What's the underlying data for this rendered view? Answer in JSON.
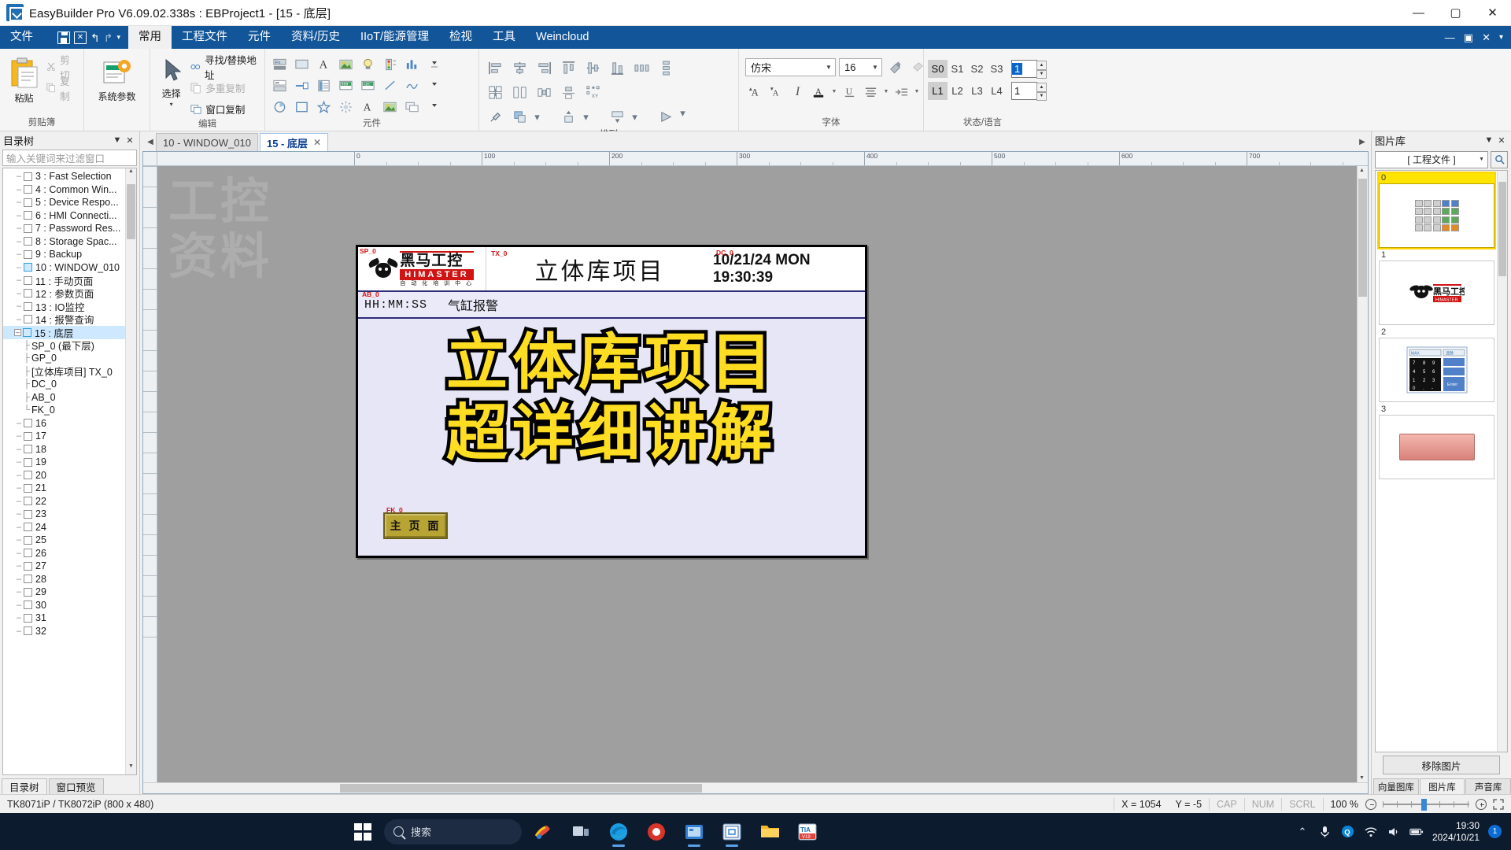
{
  "titlebar": {
    "title": "EasyBuilder Pro V6.09.02.338s : EBProject1 - [15 - 底层]",
    "minimize": "—",
    "maximize": "▢",
    "close": "✕",
    "app_icon": "easybuilder-logo-icon"
  },
  "menubar": {
    "items": [
      {
        "label": "文件",
        "active": false
      },
      {
        "label": "常用",
        "active": true
      },
      {
        "label": "工程文件",
        "active": false
      },
      {
        "label": "元件",
        "active": false
      },
      {
        "label": "资料/历史",
        "active": false
      },
      {
        "label": "IIoT/能源管理",
        "active": false
      },
      {
        "label": "检视",
        "active": false
      },
      {
        "label": "工具",
        "active": false
      },
      {
        "label": "Weincloud",
        "active": false
      }
    ],
    "quick_access": [
      "save-icon",
      "export-icon",
      "undo-icon",
      "redo-icon",
      "customize-icon"
    ],
    "window_controls": [
      "—",
      "▣",
      "✕",
      "▾"
    ]
  },
  "ribbon": {
    "groups": [
      {
        "name": "剪贴簿",
        "paste_label": "粘贴",
        "cut_label": "剪切",
        "copy_label": "复制"
      },
      {
        "name": "",
        "sysparam_label": "系统参数"
      },
      {
        "name": "编辑",
        "select_label": "选择",
        "find_replace_label": "寻找/替换地址",
        "multi_copy_label": "多重复制",
        "window_copy_label": "窗口复制"
      },
      {
        "name": "元件"
      },
      {
        "name": "排列"
      },
      {
        "name": "字体",
        "font_family": "仿宋",
        "font_size": "16"
      },
      {
        "name": "状态/语言",
        "states": [
          "S0",
          "S1",
          "S2",
          "S3"
        ],
        "state_selected": "S0",
        "state_value": "1",
        "langs": [
          "L1",
          "L2",
          "L3",
          "L4"
        ],
        "lang_selected": "L1",
        "lang_value": "1"
      }
    ]
  },
  "left_panel": {
    "header": "目录树",
    "header_icons": [
      "chevron-down-icon",
      "close-icon"
    ],
    "filter_placeholder": "输入关键词来过滤窗口",
    "tree": [
      {
        "label": "3 : Fast Selection",
        "type": "window",
        "indent": 0
      },
      {
        "label": "4 : Common Win...",
        "type": "window",
        "indent": 0
      },
      {
        "label": "5 : Device Respo...",
        "type": "window",
        "indent": 0
      },
      {
        "label": "6 : HMI Connecti...",
        "type": "window",
        "indent": 0
      },
      {
        "label": "7 : Password Res...",
        "type": "window",
        "indent": 0
      },
      {
        "label": "8 : Storage Spac...",
        "type": "window",
        "indent": 0
      },
      {
        "label": "9 : Backup",
        "type": "window",
        "indent": 0
      },
      {
        "label": "10 : WINDOW_010",
        "type": "window-open",
        "indent": 0
      },
      {
        "label": "11 : 手动页面",
        "type": "window",
        "indent": 0
      },
      {
        "label": "12 : 参数页面",
        "type": "window",
        "indent": 0
      },
      {
        "label": "13 : IO监控",
        "type": "window",
        "indent": 0
      },
      {
        "label": "14 : 报警查询",
        "type": "window",
        "indent": 0
      },
      {
        "label": "15 : 底层",
        "type": "window-selected",
        "indent": 0,
        "expanded": true
      },
      {
        "label": "SP_0 (最下层)",
        "type": "child",
        "indent": 1
      },
      {
        "label": "GP_0",
        "type": "child",
        "indent": 1
      },
      {
        "label": "[立体库项目] TX_0",
        "type": "child",
        "indent": 1
      },
      {
        "label": "DC_0",
        "type": "child",
        "indent": 1
      },
      {
        "label": "AB_0",
        "type": "child",
        "indent": 1
      },
      {
        "label": "FK_0",
        "type": "child-last",
        "indent": 1
      },
      {
        "label": "16",
        "type": "window",
        "indent": 0
      },
      {
        "label": "17",
        "type": "window",
        "indent": 0
      },
      {
        "label": "18",
        "type": "window",
        "indent": 0
      },
      {
        "label": "19",
        "type": "window",
        "indent": 0
      },
      {
        "label": "20",
        "type": "window",
        "indent": 0
      },
      {
        "label": "21",
        "type": "window",
        "indent": 0
      },
      {
        "label": "22",
        "type": "window",
        "indent": 0
      },
      {
        "label": "23",
        "type": "window",
        "indent": 0
      },
      {
        "label": "24",
        "type": "window",
        "indent": 0
      },
      {
        "label": "25",
        "type": "window",
        "indent": 0
      },
      {
        "label": "26",
        "type": "window",
        "indent": 0
      },
      {
        "label": "27",
        "type": "window",
        "indent": 0
      },
      {
        "label": "28",
        "type": "window",
        "indent": 0
      },
      {
        "label": "29",
        "type": "window",
        "indent": 0
      },
      {
        "label": "30",
        "type": "window",
        "indent": 0
      },
      {
        "label": "31",
        "type": "window",
        "indent": 0
      },
      {
        "label": "32",
        "type": "window",
        "indent": 0
      }
    ],
    "tabs": [
      {
        "label": "目录树",
        "active": true
      },
      {
        "label": "窗口预览",
        "active": false
      }
    ]
  },
  "editor": {
    "tabs": [
      {
        "label": "10 - WINDOW_010",
        "active": false,
        "closable": false
      },
      {
        "label": "15 - 底层",
        "active": true,
        "closable": true,
        "close": "✕"
      }
    ],
    "ruler_ticks": [
      "0",
      "100",
      "200",
      "300",
      "400",
      "500",
      "600",
      "700"
    ],
    "watermark": "工控\n资料"
  },
  "hmi": {
    "logo": {
      "cn": "黑马工控",
      "en": "HIMASTER",
      "sub": "自 动 化 培 训 中 心",
      "tag": "SP_0"
    },
    "title": "立体库项目",
    "title_tag": "TX_0",
    "datetime": "10/21/24 MON 19:30:39",
    "datetime_tag": "DC_0",
    "alarm_time": "HH:MM:SS",
    "alarm_message": "气缸报警",
    "alarm_tag": "AB_0",
    "big_line1": "立体库项目",
    "big_line2": "超详细讲解",
    "home_button": "主 页 面",
    "home_button_tag": "FK_0"
  },
  "right_panel": {
    "header": "图片库",
    "header_icons": [
      "chevron-down-icon",
      "close-icon"
    ],
    "source_label": "[ 工程文件 ]",
    "search_icon": "search-icon",
    "items": [
      {
        "num": "0",
        "selected": true,
        "kind": "keypad"
      },
      {
        "num": "1",
        "selected": false,
        "kind": "logo"
      },
      {
        "num": "2",
        "selected": false,
        "kind": "keypad-blue"
      },
      {
        "num": "3",
        "selected": false,
        "kind": "button-red"
      }
    ],
    "remove_label": "移除图片",
    "tabs": [
      {
        "label": "向量图库",
        "active": false
      },
      {
        "label": "图片库",
        "active": true
      },
      {
        "label": "声音库",
        "active": false
      }
    ]
  },
  "statusbar": {
    "model": "TK8071iP / TK8072iP (800 x 480)",
    "coord_x": "X = 1054",
    "coord_y": "Y = -5",
    "caps": "CAP",
    "num": "NUM",
    "scrl": "SCRL",
    "zoom": "100 %"
  },
  "taskbar": {
    "start_icon": "windows-start-icon",
    "search_placeholder": "搜索",
    "search_icon": "search-icon",
    "apps": [
      {
        "name": "windows-widgets-icon"
      },
      {
        "name": "search-taskbar-icon"
      },
      {
        "name": "paint-icon"
      },
      {
        "name": "task-view-icon"
      },
      {
        "name": "edge-browser-icon"
      },
      {
        "name": "recorder-icon"
      },
      {
        "name": "app-blue-icon"
      },
      {
        "name": "easybuilder-icon"
      },
      {
        "name": "file-explorer-icon"
      },
      {
        "name": "tia-portal-icon"
      }
    ],
    "tray": [
      "chevron-up-icon",
      "microphone-icon",
      "qq-icon",
      "wifi-icon",
      "volume-icon",
      "battery-icon"
    ],
    "clock_time": "19:30",
    "clock_date": "2024/10/21",
    "notification_count": "1"
  }
}
